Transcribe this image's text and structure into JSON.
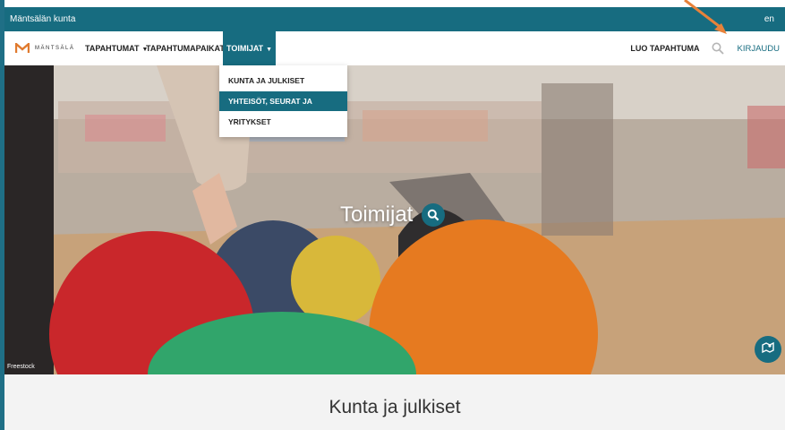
{
  "topbar": {
    "site_name": "Mäntsälän kunta",
    "language": "en"
  },
  "navbar": {
    "logo_text": "MÄNTSÄLÄ",
    "items": [
      {
        "label": "TAPAHTUMAT"
      },
      {
        "label": "TAPAHTUMAPAIKAT"
      },
      {
        "label": "TOIMIJAT"
      }
    ],
    "create_event": "LUO TAPAHTUMA",
    "login": "KIRJAUDU"
  },
  "dropdown": {
    "items": [
      {
        "label": "KUNTA JA JULKISET"
      },
      {
        "label": "YHTEISÖT, SEURAT JA YHDISTYKSET"
      },
      {
        "label": "YRITYKSET"
      }
    ]
  },
  "hero": {
    "title": "Toimijat",
    "credit": "Freestock"
  },
  "section": {
    "title": "Kunta ja julkiset"
  },
  "colors": {
    "accent": "#176c80",
    "annotation_arrow": "#e8823a"
  },
  "icons": [
    "logo-m-icon",
    "caret-down-icon",
    "search-icon",
    "map-icon",
    "annotation-arrow-icon"
  ]
}
